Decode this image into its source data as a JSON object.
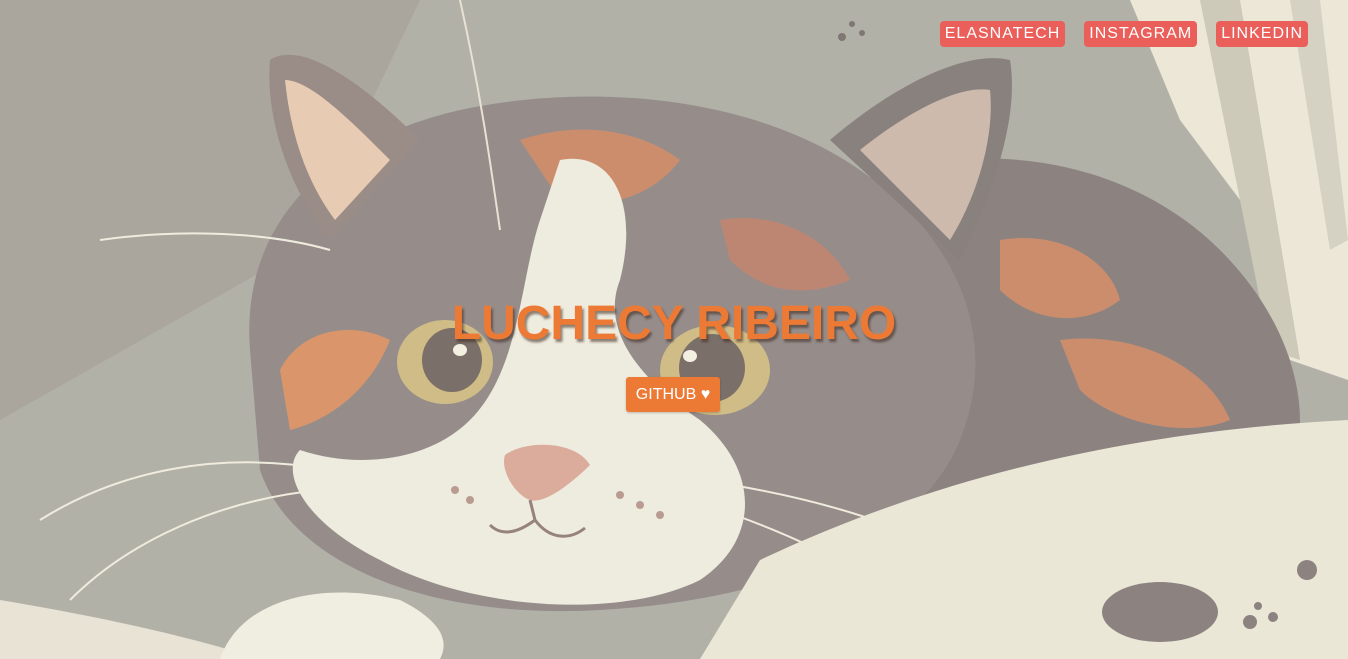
{
  "header": {
    "nav": [
      {
        "label": "ELASNATECH"
      },
      {
        "label": "INSTAGRAM"
      },
      {
        "label": "LINKEDIN"
      }
    ]
  },
  "hero": {
    "title": "LUCHECY RIBEIRO",
    "cta_label": "GITHUB ♥",
    "background_image": "calico-cat-illustration"
  },
  "colors": {
    "nav_bg": "#ea5f5a",
    "accent": "#ec7a35",
    "text_on_accent": "#ffffff"
  }
}
